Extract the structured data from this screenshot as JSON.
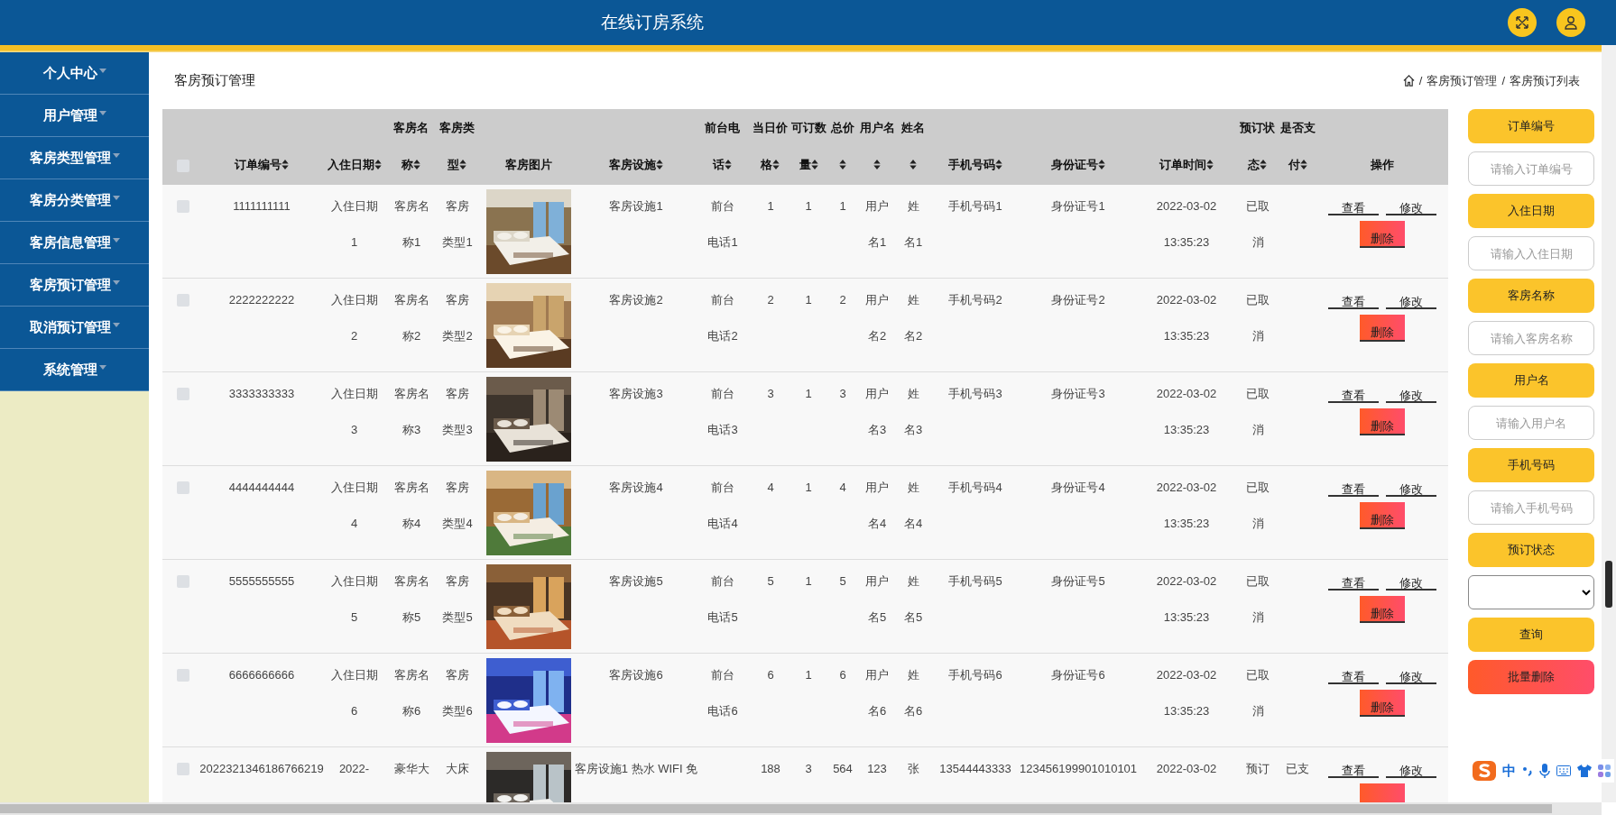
{
  "header": {
    "title": "在线订房系统"
  },
  "sidebar": {
    "items": [
      {
        "label": "个人中心"
      },
      {
        "label": "用户管理"
      },
      {
        "label": "客房类型管理"
      },
      {
        "label": "客房分类管理"
      },
      {
        "label": "客房信息管理"
      },
      {
        "label": "客房预订管理"
      },
      {
        "label": "取消预订管理"
      },
      {
        "label": "系统管理"
      }
    ]
  },
  "page_title": "客房预订管理",
  "breadcrumb": [
    {
      "kind": "home"
    },
    {
      "kind": "sep",
      "text": "/"
    },
    {
      "kind": "link",
      "text": "客房预订管理"
    },
    {
      "kind": "sep",
      "text": "/"
    },
    {
      "kind": "link",
      "text": "客房预订列表"
    }
  ],
  "table": {
    "columns": [
      {
        "kind": "checkbox",
        "checked": false
      },
      {
        "kind": "text",
        "label": "订单编号",
        "sortable": true
      },
      {
        "kind": "text",
        "label": "入住日期",
        "sortable": true
      },
      {
        "kind": "text",
        "label": "客房名称",
        "sortable": true
      },
      {
        "kind": "text",
        "label": "客房类型",
        "sortable": true
      },
      {
        "kind": "text",
        "label": "客房图片",
        "sortable": false
      },
      {
        "kind": "text",
        "label": "客房设施",
        "sortable": true
      },
      {
        "kind": "text",
        "label": "前台电话",
        "sortable": true
      },
      {
        "kind": "text",
        "label": "当日价格",
        "sortable": true
      },
      {
        "kind": "text",
        "label": "可订数量",
        "sortable": true
      },
      {
        "kind": "text",
        "label": "总价",
        "sortable": true
      },
      {
        "kind": "text",
        "label": "用户名",
        "sortable": true
      },
      {
        "kind": "text",
        "label": "姓名",
        "sortable": true
      },
      {
        "kind": "text",
        "label": "手机号码",
        "sortable": true
      },
      {
        "kind": "text",
        "label": "身份证号",
        "sortable": true
      },
      {
        "kind": "text",
        "label": "订单时间",
        "sortable": true
      },
      {
        "kind": "text",
        "label": "预订状态",
        "sortable": true
      },
      {
        "kind": "text",
        "label": "是否支付",
        "sortable": true
      },
      {
        "kind": "text",
        "label": "操作",
        "sortable": false
      }
    ],
    "rows": [
      {
        "checked": false,
        "order_no": "1111111111",
        "checkin": "入住日期1",
        "room_name": "客房名称1",
        "room_type": "客房类型1",
        "facilities": "客房设施1",
        "desk_phone": "前台电话1",
        "price": "1",
        "available": "1",
        "total": "1",
        "username": "用户名1",
        "name": "姓名1",
        "phone": "手机号码1",
        "id_no": "身份证号1",
        "order_time": "2022-03-02 13:35:23",
        "status": "已取消",
        "actions": {
          "view": "查看",
          "edit": "修改",
          "delete": "删除"
        }
      },
      {
        "checked": false,
        "order_no": "2222222222",
        "checkin": "入住日期2",
        "room_name": "客房名称2",
        "room_type": "客房类型2",
        "facilities": "客房设施2",
        "desk_phone": "前台电话2",
        "price": "2",
        "available": "1",
        "total": "2",
        "username": "用户名2",
        "name": "姓名2",
        "phone": "手机号码2",
        "id_no": "身份证号2",
        "order_time": "2022-03-02 13:35:23",
        "status": "已取消",
        "actions": {
          "view": "查看",
          "edit": "修改",
          "delete": "删除"
        }
      },
      {
        "checked": false,
        "order_no": "3333333333",
        "checkin": "入住日期3",
        "room_name": "客房名称3",
        "room_type": "客房类型3",
        "facilities": "客房设施3",
        "desk_phone": "前台电话3",
        "price": "3",
        "available": "1",
        "total": "3",
        "username": "用户名3",
        "name": "姓名3",
        "phone": "手机号码3",
        "id_no": "身份证号3",
        "order_time": "2022-03-02 13:35:23",
        "status": "已取消",
        "actions": {
          "view": "查看",
          "edit": "修改",
          "delete": "删除"
        }
      },
      {
        "checked": false,
        "order_no": "4444444444",
        "checkin": "入住日期4",
        "room_name": "客房名称4",
        "room_type": "客房类型4",
        "facilities": "客房设施4",
        "desk_phone": "前台电话4",
        "price": "4",
        "available": "1",
        "total": "4",
        "username": "用户名4",
        "name": "姓名4",
        "phone": "手机号码4",
        "id_no": "身份证号4",
        "order_time": "2022-03-02 13:35:23",
        "status": "已取消",
        "actions": {
          "view": "查看",
          "edit": "修改",
          "delete": "删除"
        }
      },
      {
        "checked": false,
        "order_no": "5555555555",
        "checkin": "入住日期5",
        "room_name": "客房名称5",
        "room_type": "客房类型5",
        "facilities": "客房设施5",
        "desk_phone": "前台电话5",
        "price": "5",
        "available": "1",
        "total": "5",
        "username": "用户名5",
        "name": "姓名5",
        "phone": "手机号码5",
        "id_no": "身份证号5",
        "order_time": "2022-03-02 13:35:23",
        "status": "已取消",
        "actions": {
          "view": "查看",
          "edit": "修改",
          "delete": "删除"
        }
      },
      {
        "checked": false,
        "order_no": "6666666666",
        "checkin": "入住日期6",
        "room_name": "客房名称6",
        "room_type": "客房类型6",
        "facilities": "客房设施6",
        "desk_phone": "前台电话6",
        "price": "6",
        "available": "1",
        "total": "6",
        "username": "用户名6",
        "name": "姓名6",
        "phone": "手机号码6",
        "id_no": "身份证号6",
        "order_time": "2022-03-02 13:35:23",
        "status": "已取消",
        "actions": {
          "view": "查看",
          "edit": "修改",
          "delete": "删除"
        }
      },
      {
        "checked": false,
        "order_no": "2022321346186766219",
        "checkin": "2022-",
        "room_name": "豪华大",
        "room_type": "大床",
        "facilities": "客房设施1 热水 WIFI 免",
        "price": "188",
        "available": "3",
        "total": "564",
        "username": "123",
        "name": "张",
        "phone": "13544443333",
        "id_no": "123456199901010101",
        "order_time": "2022-03-02",
        "status": "预订",
        "paid": "已支",
        "actions": {
          "view": "查看",
          "edit": "修改"
        }
      }
    ]
  },
  "filters": [
    {
      "kind": "input",
      "label": "订单编号",
      "placeholder": "请输入订单编号"
    },
    {
      "kind": "input",
      "label": "入住日期",
      "placeholder": "请输入入住日期"
    },
    {
      "kind": "input",
      "label": "客房名称",
      "placeholder": "请输入客房名称"
    },
    {
      "kind": "input",
      "label": "用户名",
      "placeholder": "请输入用户名"
    },
    {
      "kind": "input",
      "label": "手机号码",
      "placeholder": "请输入手机号码"
    },
    {
      "kind": "select",
      "label": "预订状态"
    }
  ],
  "search_button": "查询",
  "batch_delete_button": "批量删除",
  "ime_toolbar": {
    "mode": "中"
  }
}
